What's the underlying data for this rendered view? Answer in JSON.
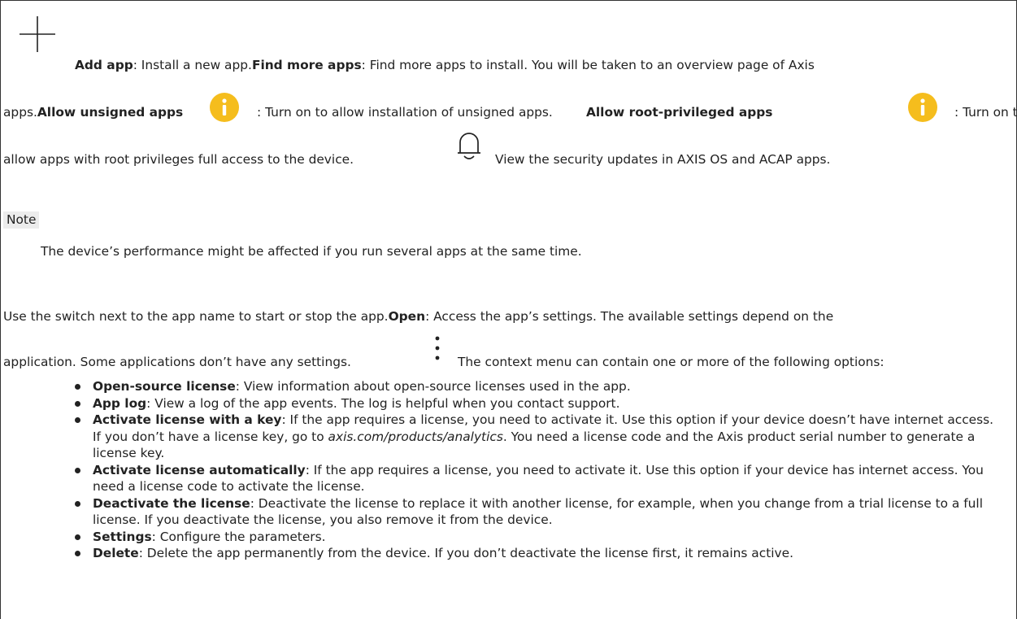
{
  "intro": {
    "add_app_label": "Add app",
    "add_app_desc": ": Install a new app.",
    "find_more_label": "Find more apps",
    "find_more_desc": ": Find more apps to install. You will be taken to an overview page of Axis",
    "apps_prefix": "apps.",
    "unsigned_label": "Allow unsigned apps",
    "unsigned_desc": ": Turn on to allow installation of unsigned apps.",
    "root_label": "Allow root-privileged apps",
    "root_desc": ": Turn on to",
    "root_desc_cont": "allow apps with root privileges full access to the device.",
    "security_desc": "View the security updates in AXIS OS and ACAP apps."
  },
  "note": {
    "tag": "Note",
    "text": "The device’s performance might be affected if you run several apps at the same time."
  },
  "app_controls": {
    "line1_a": "Use the switch next to the app name to start or stop the app.",
    "open_label": "Open",
    "line1_b": ": Access the app’s settings. The available settings depend on the",
    "line2_a": "application. Some applications don’t have any settings.",
    "line2_b": "The context menu can contain one or more of the following options:"
  },
  "options": [
    {
      "label": "Open-source license",
      "text": ": View information about open-source licenses used in the app."
    },
    {
      "label": "App log",
      "text": ": View a log of the app events. The log is helpful when you contact support."
    },
    {
      "label": "Activate license with a key",
      "text": ": If the app requires a license, you need to activate it. Use this option if your device doesn’t have internet access.",
      "sub_a": "If you don’t have a license key, go to ",
      "sub_link": "axis.com/products/analytics",
      "sub_b": ". You need a license code and the Axis product serial number to generate a license key."
    },
    {
      "label": "Activate license automatically",
      "text": ": If the app requires a license, you need to activate it. Use this option if your device has internet access. You need a license code to activate the license."
    },
    {
      "label": "Deactivate the license",
      "text": ": Deactivate the license to replace it with another license, for example, when you change from a trial license to a full license. If you deactivate the license, you also remove it from the device."
    },
    {
      "label": "Settings",
      "text": ": Configure the parameters."
    },
    {
      "label": "Delete",
      "text": ": Delete the app permanently from the device. If you don’t deactivate the license first, it remains active."
    }
  ],
  "icons": {
    "plus": "plus-icon",
    "info": "info-icon",
    "bell": "bell-icon",
    "kebab": "context-menu-icon"
  },
  "colors": {
    "info_icon": "#f5bd1d",
    "note_bg": "#ececec"
  }
}
